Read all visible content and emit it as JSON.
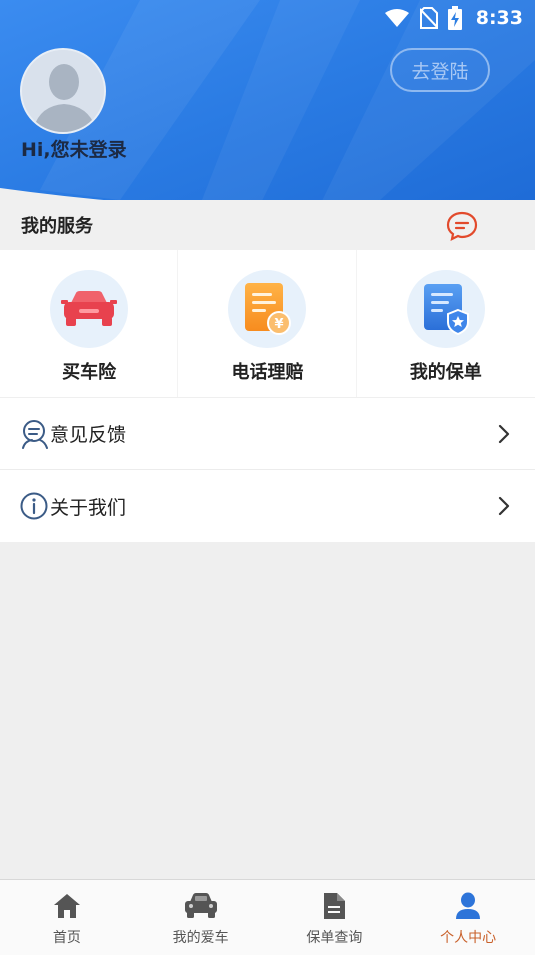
{
  "status_bar": {
    "time": "8:33",
    "icons": [
      "wifi-icon",
      "no-sim-icon",
      "battery-charging-icon"
    ]
  },
  "header": {
    "greeting": "Hi,您未登录",
    "login_label": "去登陆",
    "avatar": "default-avatar"
  },
  "services": {
    "title": "我的服务",
    "message_icon": "chat-bubble-icon",
    "items": [
      {
        "label": "买车险",
        "icon": "red-car-icon"
      },
      {
        "label": "电话理赔",
        "icon": "claim-document-yen-icon"
      },
      {
        "label": "我的保单",
        "icon": "policy-shield-icon"
      }
    ]
  },
  "menu": [
    {
      "label": "意见反馈",
      "icon": "feedback-icon"
    },
    {
      "label": "关于我们",
      "icon": "info-icon"
    }
  ],
  "tabs": [
    {
      "label": "首页",
      "icon": "home-icon",
      "active": false
    },
    {
      "label": "我的爱车",
      "icon": "car-icon",
      "active": false
    },
    {
      "label": "保单查询",
      "icon": "document-icon",
      "active": false
    },
    {
      "label": "个人中心",
      "icon": "person-icon",
      "active": true
    }
  ],
  "colors": {
    "header_blue": "#2c7ee3",
    "accent_orange": "#c9612b",
    "active_tab_icon": "#2d74d9"
  }
}
